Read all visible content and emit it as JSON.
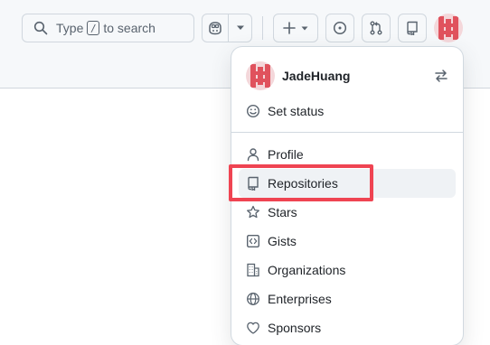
{
  "header": {
    "search": {
      "prefix": "Type",
      "shortcut": "/",
      "suffix": "to search"
    },
    "copilot_icon": "copilot-icon",
    "dropdown_icon": "triangle-down-icon",
    "create_icon": "plus-icon",
    "issues_icon": "issue-opened-icon",
    "pulls_icon": "git-pull-request-icon",
    "repo_icon": "repo-icon"
  },
  "menu": {
    "username": "JadeHuang",
    "switch_icon": "arrow-switch-icon",
    "items": [
      {
        "label": "Set status",
        "icon": "smiley-icon"
      },
      {
        "label": "Profile",
        "icon": "person-icon"
      },
      {
        "label": "Repositories",
        "icon": "repo-icon"
      },
      {
        "label": "Stars",
        "icon": "star-icon"
      },
      {
        "label": "Gists",
        "icon": "code-square-icon"
      },
      {
        "label": "Organizations",
        "icon": "organization-icon"
      },
      {
        "label": "Enterprises",
        "icon": "globe-icon"
      },
      {
        "label": "Sponsors",
        "icon": "heart-icon"
      }
    ]
  },
  "colors": {
    "highlight": "#ef4452",
    "avatar_red": "#e0525d",
    "avatar_bg": "#f3d0d3"
  }
}
